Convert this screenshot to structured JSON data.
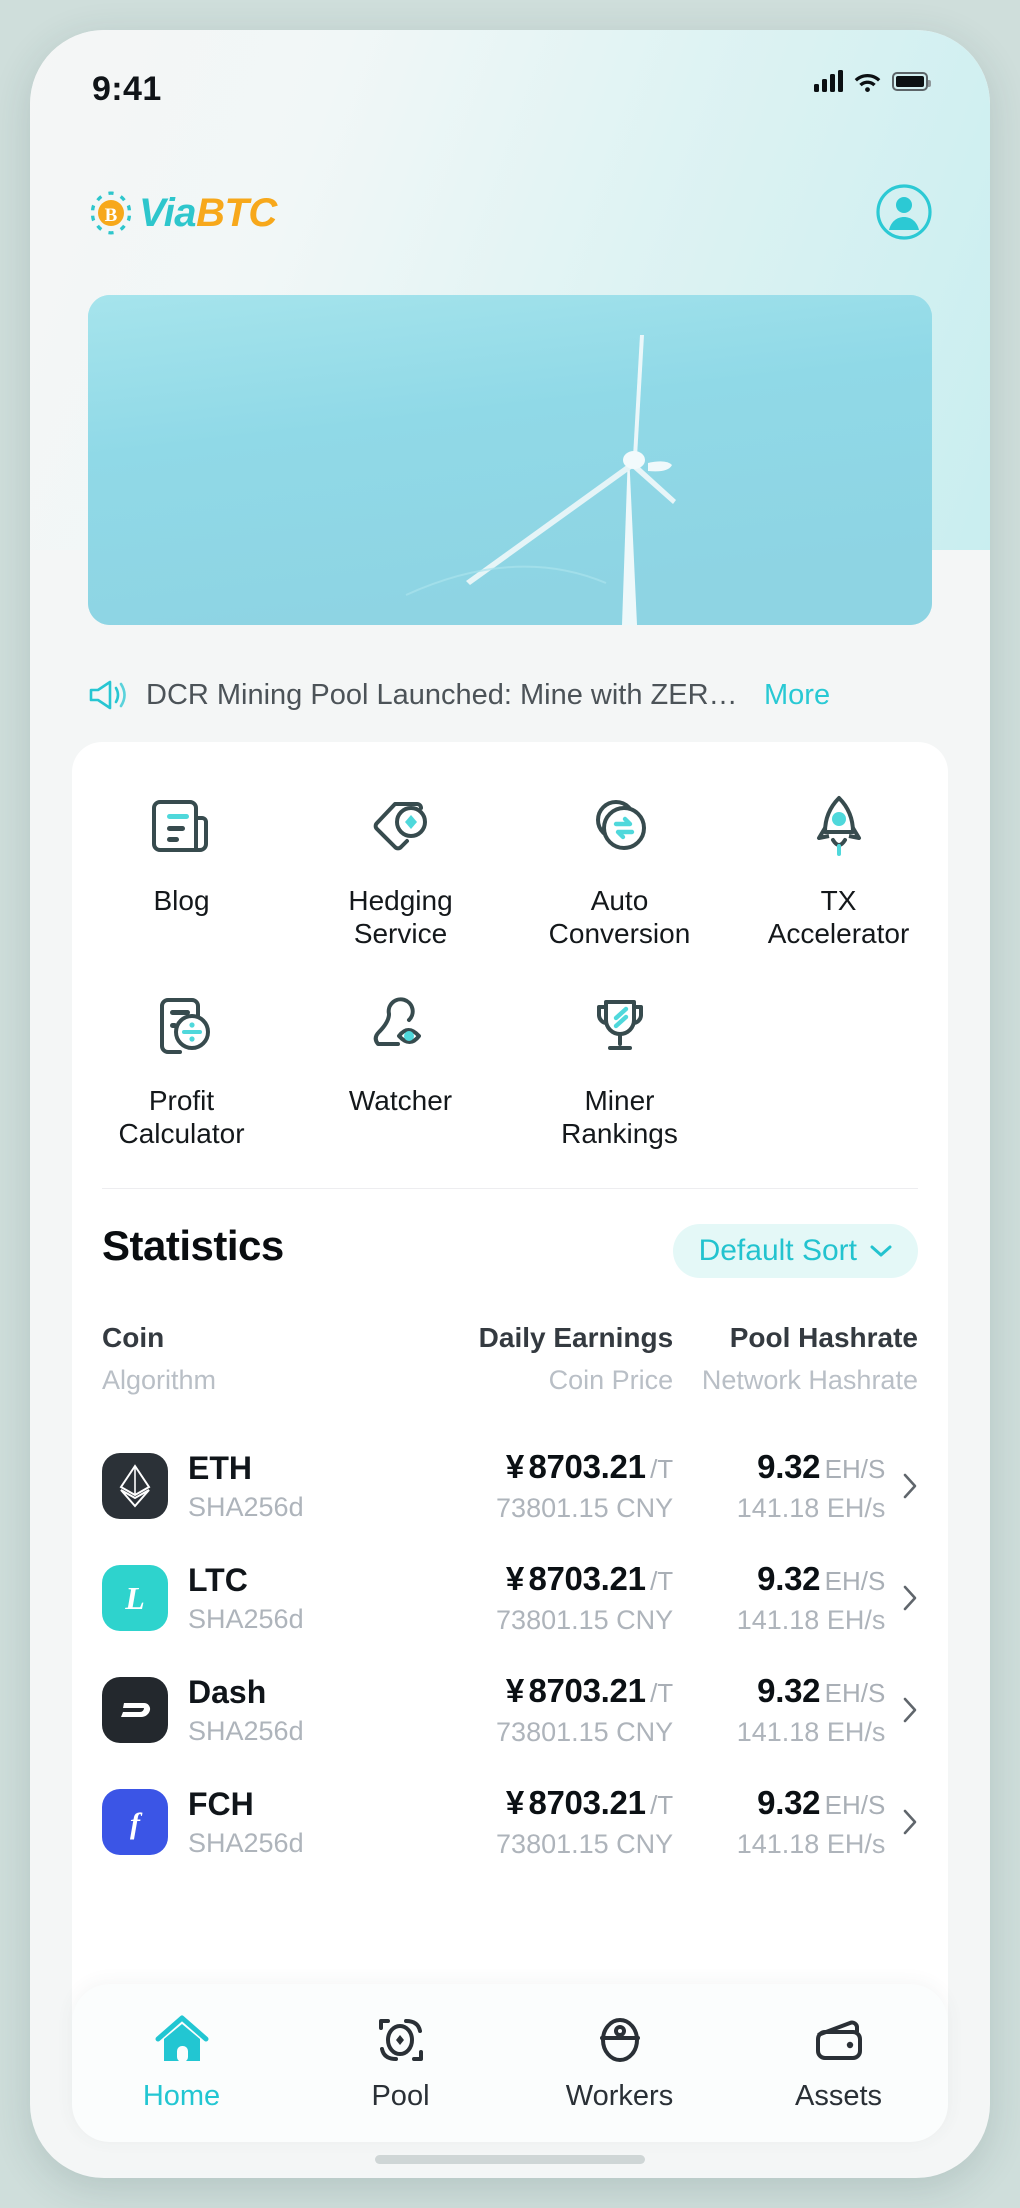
{
  "status_bar": {
    "time": "9:41",
    "signal_icon": "cellular-signal-icon",
    "wifi_icon": "wifi-icon",
    "battery_icon": "battery-full-icon"
  },
  "header": {
    "logo_mark": "bitcoin-logo-icon",
    "logo_part1": "Via",
    "logo_part2": "BTC",
    "account_icon": "account-avatar-icon"
  },
  "banner": {
    "image_alt": "wind-turbine-banner",
    "sky_color": "#92dbe8"
  },
  "announcement": {
    "icon": "megaphone-icon",
    "text": "DCR Mining Pool Launched: Mine with ZERO ...",
    "more_label": "More"
  },
  "features": [
    {
      "label": "Blog",
      "icon": "blog-document-icon"
    },
    {
      "label": "Hedging\nService",
      "label_line1": "Hedging",
      "label_line2": "Service",
      "icon": "hedging-tag-icon"
    },
    {
      "label": "Auto\nConversion",
      "label_line1": "Auto",
      "label_line2": "Conversion",
      "icon": "auto-conversion-icon"
    },
    {
      "label": "TX\nAccelerator",
      "label_line1": "TX",
      "label_line2": "Accelerator",
      "icon": "rocket-icon"
    },
    {
      "label": "Profit\nCalculator",
      "label_line1": "Profit",
      "label_line2": "Calculator",
      "icon": "calculator-icon"
    },
    {
      "label": "Watcher",
      "icon": "watcher-eye-icon"
    },
    {
      "label": "Miner\nRankings",
      "label_line1": "Miner",
      "label_line2": "Rankings",
      "icon": "trophy-icon"
    }
  ],
  "statistics": {
    "title": "Statistics",
    "sort_label": "Default Sort",
    "sort_icon": "chevron-down-icon",
    "columns": [
      {
        "main": "Coin",
        "sub": "Algorithm"
      },
      {
        "main": "Daily Earnings",
        "sub": "Coin Price"
      },
      {
        "main": "Pool Hashrate",
        "sub": "Network Hashrate"
      }
    ],
    "rows": [
      {
        "coin": "ETH",
        "algorithm": "SHA256d",
        "icon": "ethereum-icon",
        "icon_bg": "#2b3137",
        "icon_fg": "#ffffff",
        "earnings_currency": "¥",
        "earnings_value": "8703.21",
        "earnings_unit": "/T",
        "price": "73801.15",
        "price_unit": "CNY",
        "pool_hashrate": "9.32",
        "pool_hashrate_unit": "EH/S",
        "network_hashrate": "141.18",
        "network_hashrate_unit": "EH/s",
        "chevron": "chevron-right-icon"
      },
      {
        "coin": "LTC",
        "algorithm": "SHA256d",
        "icon": "litecoin-icon",
        "icon_bg": "#2ed3cd",
        "icon_fg": "#ffffff",
        "earnings_currency": "¥",
        "earnings_value": "8703.21",
        "earnings_unit": "/T",
        "price": "73801.15",
        "price_unit": "CNY",
        "pool_hashrate": "9.32",
        "pool_hashrate_unit": "EH/S",
        "network_hashrate": "141.18",
        "network_hashrate_unit": "EH/s",
        "chevron": "chevron-right-icon"
      },
      {
        "coin": "Dash",
        "algorithm": "SHA256d",
        "icon": "dash-icon",
        "icon_bg": "#23282d",
        "icon_fg": "#ffffff",
        "earnings_currency": "¥",
        "earnings_value": "8703.21",
        "earnings_unit": "/T",
        "price": "73801.15",
        "price_unit": "CNY",
        "pool_hashrate": "9.32",
        "pool_hashrate_unit": "EH/S",
        "network_hashrate": "141.18",
        "network_hashrate_unit": "EH/s",
        "chevron": "chevron-right-icon"
      },
      {
        "coin": "FCH",
        "algorithm": "SHA256d",
        "icon": "freecash-icon",
        "icon_bg": "#3b55e6",
        "icon_fg": "#ffffff",
        "earnings_currency": "¥",
        "earnings_value": "8703.21",
        "earnings_unit": "/T",
        "price": "73801.15",
        "price_unit": "CNY",
        "pool_hashrate": "9.32",
        "pool_hashrate_unit": "EH/S",
        "network_hashrate": "141.18",
        "network_hashrate_unit": "EH/s",
        "chevron": "chevron-right-icon"
      }
    ]
  },
  "tabbar": {
    "items": [
      {
        "label": "Home",
        "icon": "home-icon",
        "active": true
      },
      {
        "label": "Pool",
        "icon": "pool-icon",
        "active": false
      },
      {
        "label": "Workers",
        "icon": "workers-helmet-icon",
        "active": false
      },
      {
        "label": "Assets",
        "icon": "wallet-icon",
        "active": false
      }
    ]
  },
  "theme": {
    "accent": "#22c6d2",
    "accent_orange": "#f7a81b",
    "icon_dark": "#374b4e",
    "muted": "#aeb4bb"
  }
}
